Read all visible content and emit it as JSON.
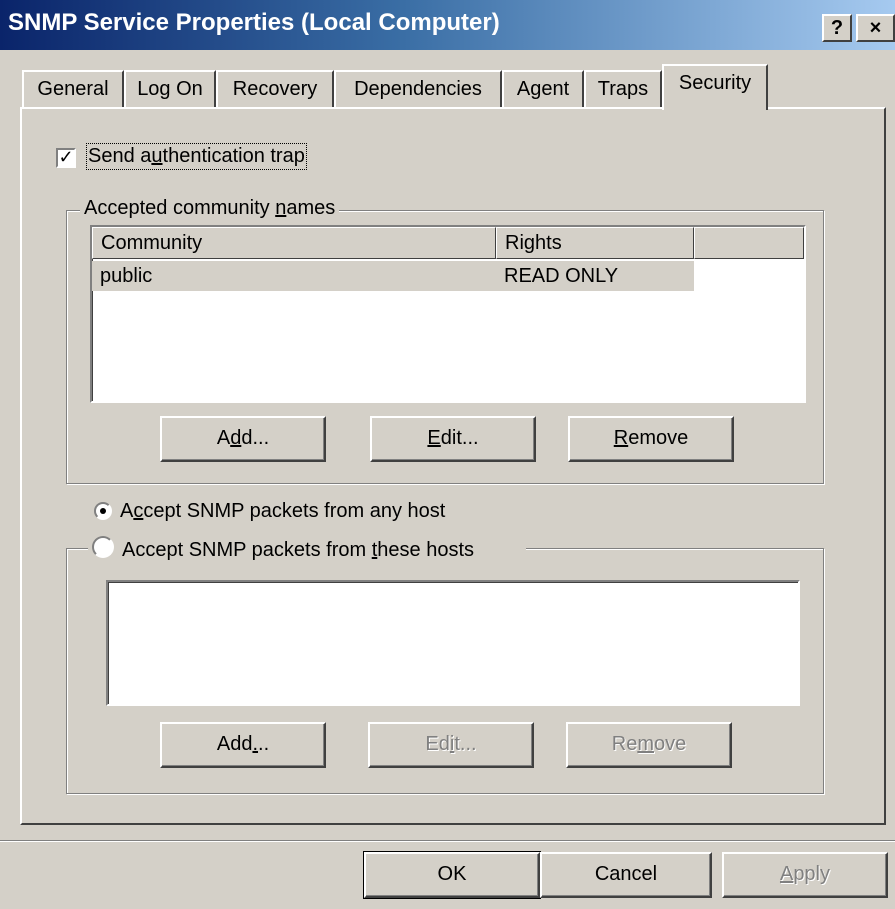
{
  "window": {
    "title": "SNMP Service Properties (Local Computer)",
    "help_button": "?",
    "close_button": "×"
  },
  "tabs": [
    {
      "label": "General"
    },
    {
      "label": "Log On"
    },
    {
      "label": "Recovery"
    },
    {
      "label": "Dependencies"
    },
    {
      "label": "Agent"
    },
    {
      "label": "Traps"
    },
    {
      "label": "Security",
      "active": true
    }
  ],
  "auth_trap": {
    "checked": true,
    "check_glyph": "✓",
    "label_pre": "Send a",
    "label_key": "u",
    "label_post": "thentication trap"
  },
  "community_group": {
    "legend_pre": "Accepted community ",
    "legend_key": "n",
    "legend_post": "ames",
    "columns": [
      "Community",
      "Rights"
    ],
    "rows": [
      {
        "community": "public",
        "rights": "READ ONLY"
      }
    ],
    "buttons": {
      "add": {
        "pre": "A",
        "key": "d",
        "post": "d..."
      },
      "edit": {
        "pre": "",
        "key": "E",
        "post": "dit..."
      },
      "remove": {
        "pre": "",
        "key": "R",
        "post": "emove"
      }
    }
  },
  "radio_any": {
    "selected": true,
    "pre": "A",
    "key": "c",
    "post": "cept SNMP packets from any host"
  },
  "hosts_group": {
    "radio_selected": false,
    "pre": "Accept SNMP packets from ",
    "key": "t",
    "post": "hese hosts",
    "buttons": {
      "add": {
        "pre": "Add",
        "key": ".",
        "post": "..",
        "disabled": false
      },
      "edit": {
        "pre": "Ed",
        "key": "i",
        "post": "t...",
        "disabled": true
      },
      "remove": {
        "pre": "Re",
        "key": "m",
        "post": "ove",
        "disabled": true
      }
    }
  },
  "footer": {
    "ok": "OK",
    "cancel": "Cancel",
    "apply_key": "A",
    "apply_post": "pply"
  }
}
